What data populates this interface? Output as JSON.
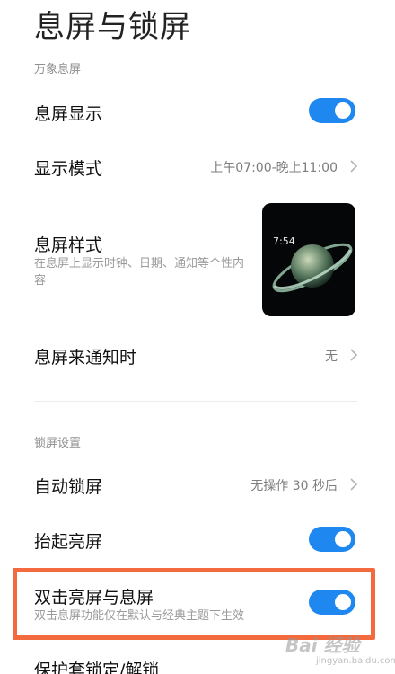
{
  "header": {
    "title": "息屏与锁屏"
  },
  "section_always_on": {
    "title": "万象息屏",
    "aod_display": {
      "label": "息屏显示",
      "on": true
    },
    "display_mode": {
      "label": "显示模式",
      "value": "上午07:00-晚上11:00"
    },
    "aod_style": {
      "label": "息屏样式",
      "description": "在息屏上显示时钟、日期、通知等个性内容",
      "preview_time": "7:54"
    },
    "on_notification": {
      "label": "息屏来通知时",
      "value": "无"
    }
  },
  "section_lock": {
    "title": "锁屏设置",
    "auto_lock": {
      "label": "自动锁屏",
      "value": "无操作 30 秒后"
    },
    "raise_to_wake": {
      "label": "抬起亮屏",
      "on": true
    },
    "double_tap": {
      "label": "双击亮屏与息屏",
      "description": "双击息屏功能仅在默认与经典主题下生效",
      "on": true
    },
    "cover_lock": {
      "label": "保护套锁定/解锁"
    }
  },
  "colors": {
    "accent": "#1e87f0",
    "highlight": "#f26a3d"
  },
  "watermark": {
    "brand": "Bai 经验",
    "url": "jingyan.baidu.com"
  }
}
